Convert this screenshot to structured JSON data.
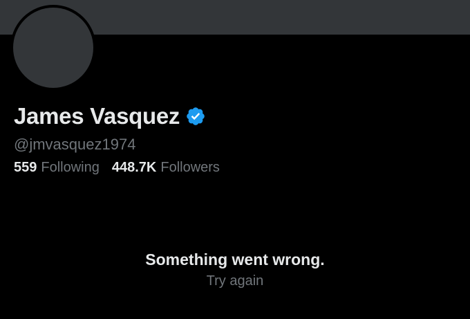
{
  "profile": {
    "display_name": "James Vasquez",
    "handle": "@jmvasquez1974",
    "verified_icon": "verified-badge-icon",
    "following_count": "559",
    "following_label": "Following",
    "followers_count": "448.7K",
    "followers_label": "Followers"
  },
  "error": {
    "title": "Something went wrong.",
    "retry_label": "Try again"
  },
  "colors": {
    "background": "#000000",
    "banner": "#333639",
    "primary_text": "#e7e9ea",
    "secondary_text": "#71767b",
    "verified_badge": "#1d9bf0"
  }
}
